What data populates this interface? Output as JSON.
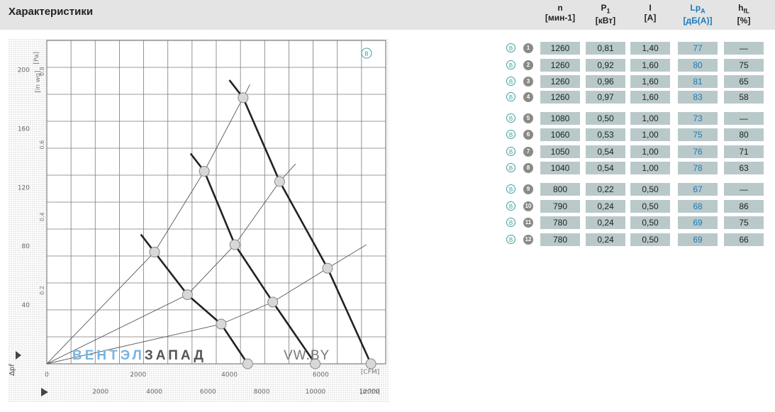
{
  "title": "Характеристики",
  "table": {
    "headers": [
      {
        "main": "n",
        "sub": "",
        "unit": "[мин-1]"
      },
      {
        "main": "P",
        "sub": "1",
        "unit": "[кВт]"
      },
      {
        "main": "I",
        "sub": "",
        "unit": "[A]"
      },
      {
        "main": "Lp",
        "sub": "A",
        "unit": "[дБ(A)]"
      },
      {
        "main": "h",
        "sub": "fL",
        "unit": "[%]"
      }
    ],
    "badge_letter": "B",
    "rows": [
      {
        "num": "1",
        "n": "1260",
        "p1": "0,81",
        "i": "1,40",
        "lpa": "77",
        "eff": "—"
      },
      {
        "num": "2",
        "n": "1260",
        "p1": "0,92",
        "i": "1,60",
        "lpa": "80",
        "eff": "75"
      },
      {
        "num": "3",
        "n": "1260",
        "p1": "0,96",
        "i": "1,60",
        "lpa": "81",
        "eff": "65"
      },
      {
        "num": "4",
        "n": "1260",
        "p1": "0,97",
        "i": "1,60",
        "lpa": "83",
        "eff": "58"
      },
      {
        "num": "5",
        "n": "1080",
        "p1": "0,50",
        "i": "1,00",
        "lpa": "73",
        "eff": "—"
      },
      {
        "num": "6",
        "n": "1060",
        "p1": "0,53",
        "i": "1,00",
        "lpa": "75",
        "eff": "80"
      },
      {
        "num": "7",
        "n": "1050",
        "p1": "0,54",
        "i": "1,00",
        "lpa": "76",
        "eff": "71"
      },
      {
        "num": "8",
        "n": "1040",
        "p1": "0,54",
        "i": "1,00",
        "lpa": "78",
        "eff": "63"
      },
      {
        "num": "9",
        "n": "800",
        "p1": "0,22",
        "i": "0,50",
        "lpa": "67",
        "eff": "—"
      },
      {
        "num": "10",
        "n": "790",
        "p1": "0,24",
        "i": "0,50",
        "lpa": "68",
        "eff": "86"
      },
      {
        "num": "11",
        "n": "780",
        "p1": "0,24",
        "i": "0,50",
        "lpa": "69",
        "eff": "75"
      },
      {
        "num": "12",
        "n": "780",
        "p1": "0,24",
        "i": "0,50",
        "lpa": "69",
        "eff": "66"
      }
    ]
  },
  "watermark": {
    "part1": "ВЕНТЭЛ",
    "part2": "ЗАПАД",
    "part3": "VW.BY"
  },
  "chart_data": {
    "type": "line",
    "corner_badge": "B",
    "x_unit_top": "[CFM]",
    "x_unit_bottom": "[m³/h]",
    "y_unit_left": "[Pa]",
    "y_unit_right": "[in wg]",
    "xlim": [
      0,
      8000
    ],
    "ylim": [
      0,
      220
    ],
    "x_ticks": [
      "0",
      "2000",
      "4000",
      "6000"
    ],
    "x_ticks_values": [
      0,
      2000,
      4000,
      6000
    ],
    "x_ticks_bottom": [
      "2000",
      "4000",
      "6000",
      "8000",
      "10000",
      "12000"
    ],
    "x_ticks_bottom_values": [
      1177,
      2354,
      3531,
      4709,
      5886,
      7063
    ],
    "y_ticks": [
      "40",
      "80",
      "120",
      "160",
      "200"
    ],
    "y_ticks_values": [
      40,
      80,
      120,
      160,
      200
    ],
    "y_ticks_right": [
      "0.2",
      "0.4",
      "0.6",
      "0.8"
    ],
    "y_ticks_right_values": [
      50,
      100,
      149,
      199
    ],
    "series": [
      {
        "points": [
          [
            4300,
            181
          ],
          [
            5100,
            124
          ],
          [
            6150,
            65
          ],
          [
            7100,
            0
          ]
        ]
      },
      {
        "points": [
          [
            3450,
            131
          ],
          [
            4120,
            81
          ],
          [
            4950,
            42
          ],
          [
            5880,
            0
          ]
        ]
      },
      {
        "points": [
          [
            2360,
            76
          ],
          [
            3080,
            47
          ],
          [
            3820,
            27
          ],
          [
            4400,
            0
          ]
        ]
      }
    ],
    "system_curves": [
      {
        "points": [
          [
            0,
            0
          ],
          [
            2360,
            76
          ],
          [
            3450,
            131
          ],
          [
            4300,
            181
          ],
          [
            4450,
            190
          ]
        ]
      },
      {
        "points": [
          [
            0,
            0
          ],
          [
            3080,
            47
          ],
          [
            4120,
            81
          ],
          [
            5100,
            124
          ],
          [
            5450,
            136
          ]
        ]
      },
      {
        "points": [
          [
            0,
            0
          ],
          [
            3820,
            27
          ],
          [
            4950,
            42
          ],
          [
            6150,
            65
          ],
          [
            7000,
            81
          ]
        ]
      }
    ],
    "markers": [
      {
        "x": 4300,
        "y": 181
      },
      {
        "x": 3450,
        "y": 131
      },
      {
        "x": 5100,
        "y": 124
      },
      {
        "x": 4120,
        "y": 81
      },
      {
        "x": 2360,
        "y": 76
      },
      {
        "x": 6150,
        "y": 65
      },
      {
        "x": 3080,
        "y": 47
      },
      {
        "x": 4950,
        "y": 42
      },
      {
        "x": 3820,
        "y": 27
      },
      {
        "x": 4400,
        "y": 0
      },
      {
        "x": 5880,
        "y": 0
      },
      {
        "x": 7100,
        "y": 0
      }
    ]
  }
}
